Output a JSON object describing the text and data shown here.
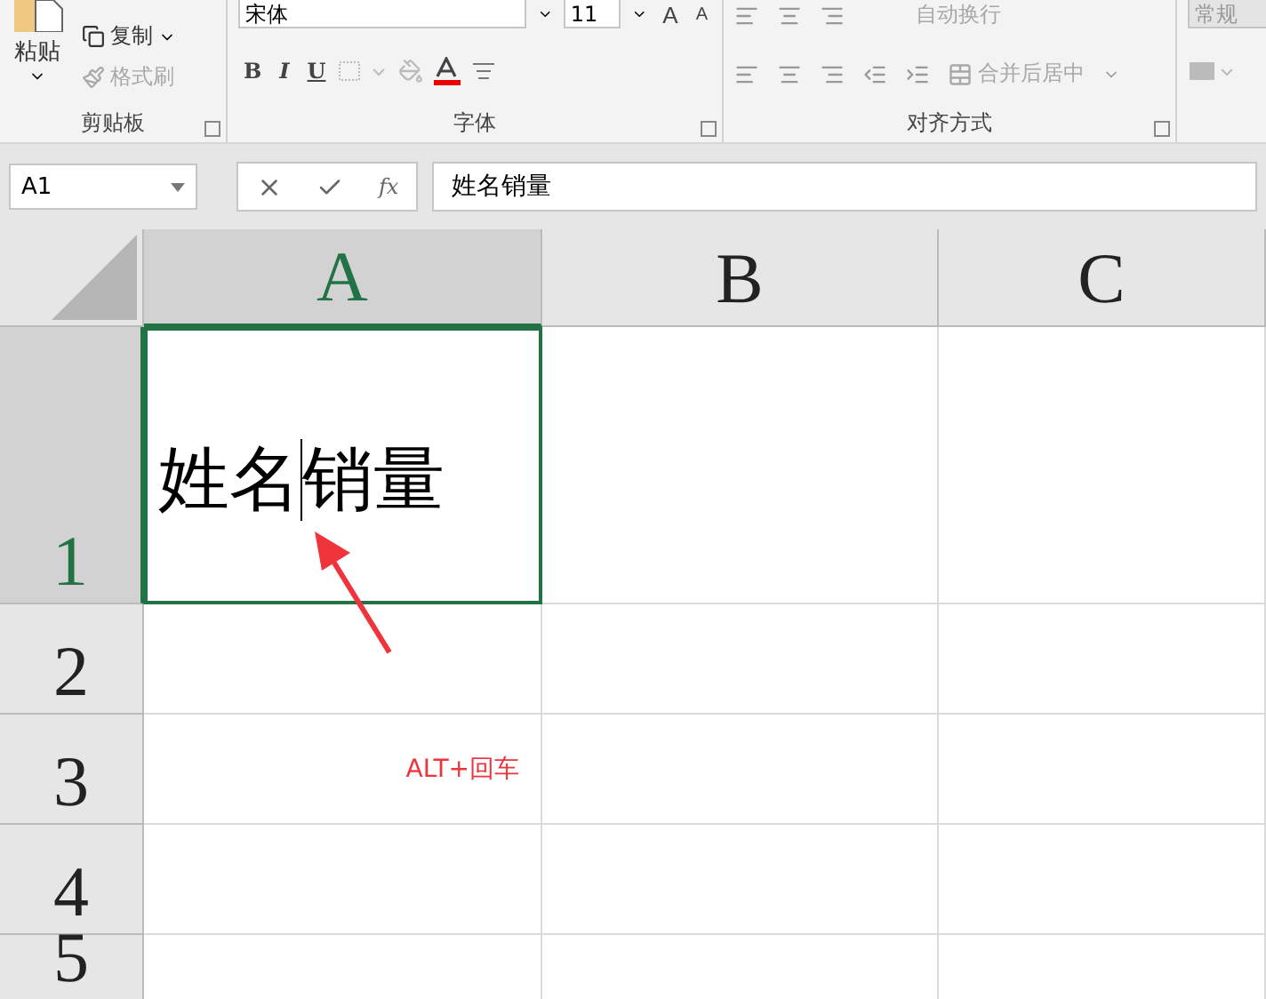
{
  "ribbon": {
    "clipboard": {
      "paste": "粘贴",
      "copy": "复制",
      "format_painter": "格式刷",
      "label": "剪贴板"
    },
    "font": {
      "name": "宋体",
      "size": "11",
      "grow": "A",
      "shrink": "A",
      "bold": "B",
      "italic": "I",
      "underline": "U",
      "label": "字体"
    },
    "alignment": {
      "wrap": "自动换行",
      "merge": "合并后居中",
      "label": "对齐方式"
    },
    "number": {
      "format": "常规"
    }
  },
  "formula_bar": {
    "name_box": "A1",
    "function": "fx",
    "value": "姓名销量"
  },
  "sheet": {
    "columns": [
      {
        "label": "A",
        "selected": true
      },
      {
        "label": "B",
        "selected": false
      },
      {
        "label": "C",
        "selected": false
      }
    ],
    "rows": [
      {
        "label": "1",
        "selected": true,
        "cells": [
          {
            "kind": "edit",
            "text_before_cursor": "姓名",
            "text_after_cursor": "销量"
          }
        ]
      },
      {
        "label": "2",
        "selected": false,
        "cells": []
      },
      {
        "label": "3",
        "selected": false,
        "cells": [
          {
            "text": "ALT+回车",
            "kind": "note"
          }
        ]
      },
      {
        "label": "4",
        "selected": false,
        "cells": []
      },
      {
        "label": "5",
        "selected": false,
        "cells": []
      }
    ]
  }
}
